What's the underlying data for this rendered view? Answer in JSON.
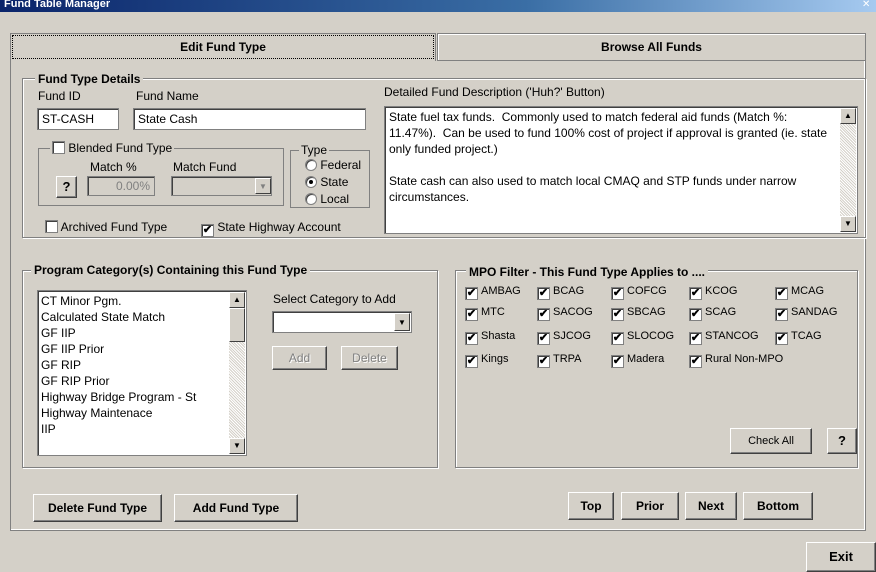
{
  "window": {
    "title": "Fund Table Manager"
  },
  "tabs": [
    {
      "label": "Edit Fund Type"
    },
    {
      "label": "Browse All Funds"
    }
  ],
  "details": {
    "legend": "Fund Type Details",
    "fund_id_label": "Fund ID",
    "fund_name_label": "Fund Name",
    "fund_id": "ST-CASH",
    "fund_name": "State Cash",
    "blended_label": "Blended Fund Type",
    "match_pct_label": "Match %",
    "match_fund_label": "Match Fund",
    "match_pct_value": "0.00%",
    "help_label": "?",
    "type_legend": "Type",
    "type_options": [
      "Federal",
      "State",
      "Local"
    ],
    "type_selected": "State",
    "archived_label": "Archived Fund Type",
    "archived_checked": false,
    "state_highway_label": "State Highway Account",
    "state_highway_checked": true,
    "desc_label": "Detailed Fund Description ('Huh?' Button)",
    "description": "State fuel tax funds.  Commonly used to match federal aid funds (Match %: 11.47%).  Can be used to fund 100% cost of project if approval is granted (ie. state only funded project.)\n\nState cash can also used to match local CMAQ and STP funds under narrow circumstances."
  },
  "program": {
    "legend": "Program Category(s) Containing this Fund Type",
    "items": [
      "CT Minor Pgm.",
      "Calculated State Match",
      "GF IIP",
      "GF IIP Prior",
      "GF RIP",
      "GF RIP Prior",
      "Highway Bridge Program - St",
      "Highway Maintenace",
      "IIP"
    ],
    "select_label": "Select Category to Add",
    "add_label": "Add",
    "delete_label": "Delete"
  },
  "mpo": {
    "legend": "MPO Filter - This Fund Type Applies to ....",
    "items": [
      "AMBAG",
      "BCAG",
      "COFCG",
      "KCOG",
      "MCAG",
      "MTC",
      "SACOG",
      "SBCAG",
      "SCAG",
      "SANDAG",
      "Shasta",
      "SJCOG",
      "SLOCOG",
      "STANCOG",
      "TCAG",
      "Kings",
      "TRPA",
      "Madera",
      "Rural Non-MPO"
    ],
    "check_all_label": "Check All",
    "help_label": "?"
  },
  "actions": {
    "delete_fund_type": "Delete Fund Type",
    "add_fund_type": "Add Fund Type",
    "top": "Top",
    "prior": "Prior",
    "next": "Next",
    "bottom": "Bottom",
    "exit": "Exit"
  },
  "check_mark": "✔"
}
